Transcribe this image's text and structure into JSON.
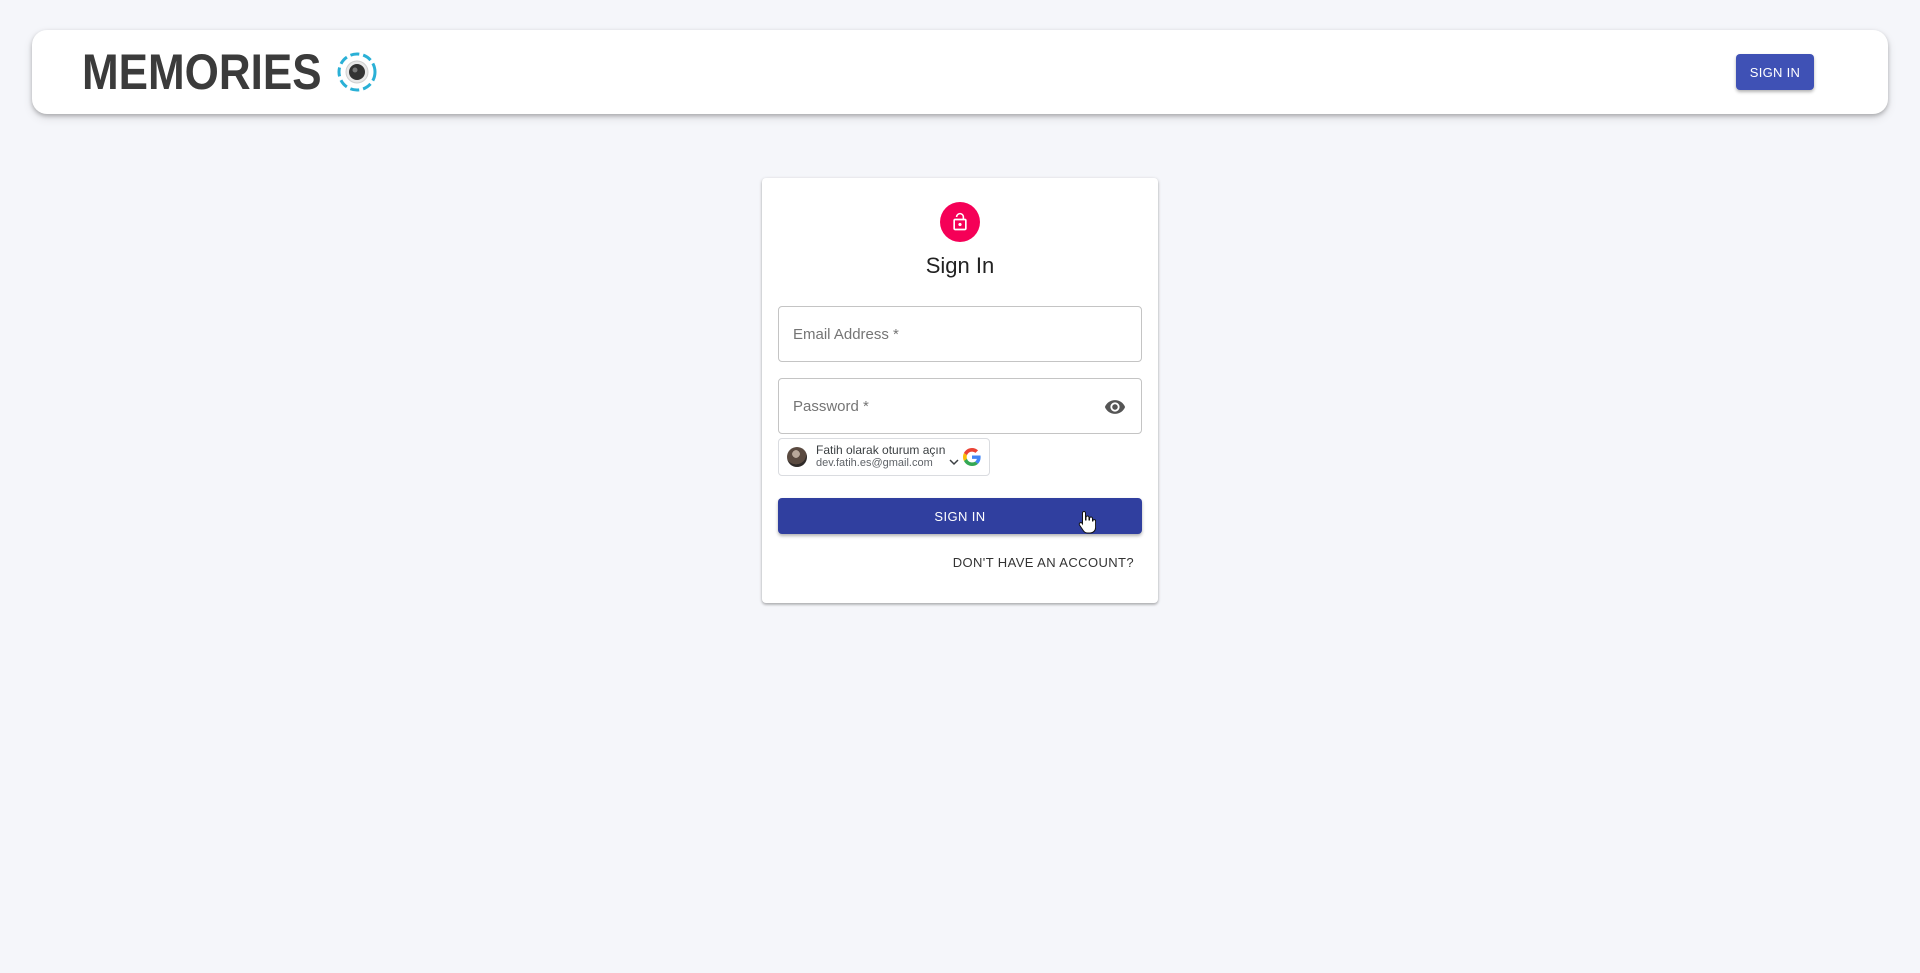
{
  "header": {
    "brand": "MEMORIES",
    "signin_label": "SIGN IN"
  },
  "auth": {
    "title": "Sign In",
    "email_placeholder": "Email Address *",
    "password_placeholder": "Password *",
    "google": {
      "line1": "Fatih olarak oturum açın",
      "line2": "dev.fatih.es@gmail.com"
    },
    "submit_label": "SIGN IN",
    "switch_label": "DON'T HAVE AN ACCOUNT?"
  },
  "colors": {
    "primary": "#3f51b5",
    "primary_dark": "#303f9f",
    "avatar_accent": "#f50057",
    "background": "#f5f6fa"
  },
  "icons": {
    "avatar": "lock-icon",
    "password_toggle": "eye-icon",
    "google": "google-icon"
  }
}
